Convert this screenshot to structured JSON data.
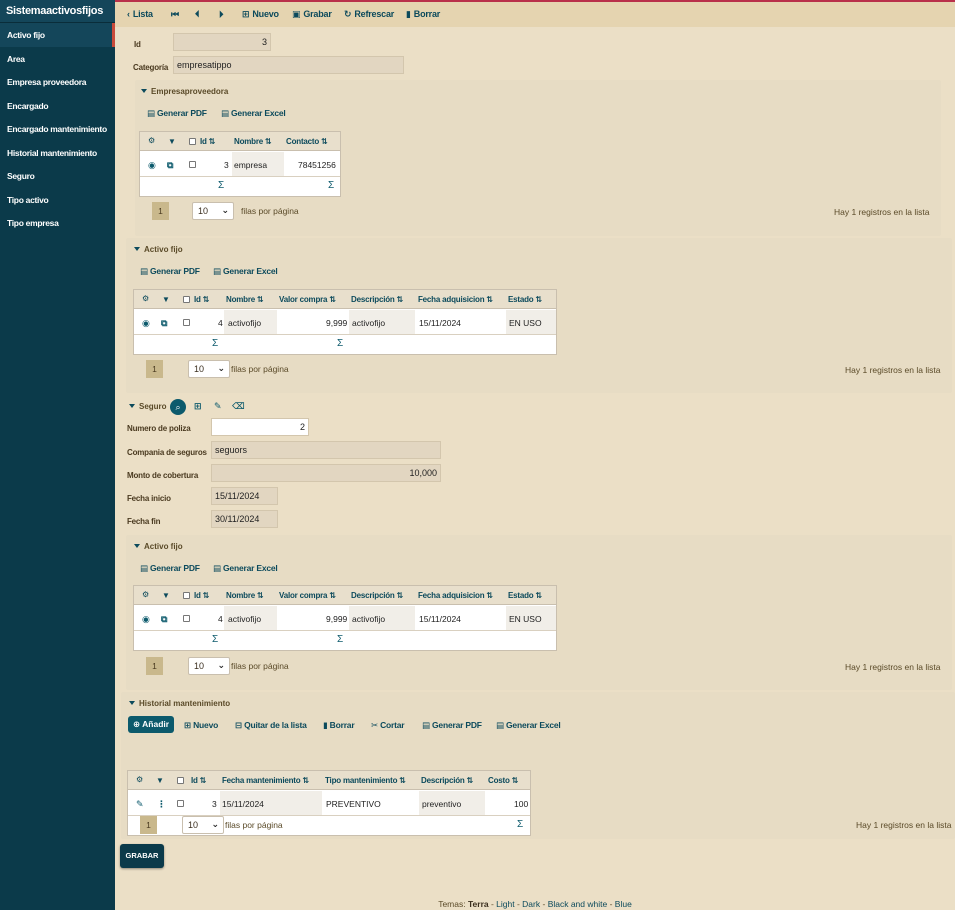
{
  "app": {
    "title": "Sistemaactivosfijos"
  },
  "sidebar": {
    "items": [
      {
        "label": "Activo fijo"
      },
      {
        "label": "Area"
      },
      {
        "label": "Empresa proveedora"
      },
      {
        "label": "Encargado"
      },
      {
        "label": "Encargado mantenimiento"
      },
      {
        "label": "Historial mantenimiento"
      },
      {
        "label": "Seguro"
      },
      {
        "label": "Tipo activo"
      },
      {
        "label": "Tipo empresa"
      }
    ]
  },
  "toolbar": {
    "lista": "Lista",
    "nuevo": "Nuevo",
    "grabar": "Grabar",
    "refrescar": "Refrescar",
    "borrar": "Borrar"
  },
  "form": {
    "id_label": "Id",
    "id_value": "3",
    "categoria_label": "Categoría",
    "categoria_value": "empresatippo"
  },
  "pdf_label": "Generar PDF",
  "excel_label": "Generar Excel",
  "per_page_label": "filas por página",
  "count_text": "Hay 1 registros en la lista",
  "page_number": "1",
  "page_size": "10",
  "sigma": "Σ",
  "empresa": {
    "title": "Empresaproveedora",
    "headers": {
      "id": "Id",
      "nombre": "Nombre",
      "contacto": "Contacto"
    },
    "row": {
      "id": "3",
      "nombre": "empresa",
      "contacto": "78451256"
    }
  },
  "activo1": {
    "title": "Activo fijo",
    "headers": {
      "id": "Id",
      "nombre": "Nombre",
      "valor": "Valor compra",
      "descripcion": "Descripción",
      "fecha": "Fecha adquisicion",
      "estado": "Estado"
    },
    "row": {
      "id": "4",
      "nombre": "activofijo",
      "valor": "9,999",
      "descripcion": "activofijo",
      "fecha": "15/11/2024",
      "estado": "EN USO"
    }
  },
  "seguro": {
    "title": "Seguro",
    "poliza_label": "Numero de poliza",
    "poliza_value": "2",
    "compania_label": "Compania de seguros",
    "compania_value": "seguors",
    "monto_label": "Monto de cobertura",
    "monto_value": "10,000",
    "inicio_label": "Fecha inicio",
    "inicio_value": "15/11/2024",
    "fin_label": "Fecha fin",
    "fin_value": "30/11/2024"
  },
  "activo2": {
    "title": "Activo fijo",
    "headers": {
      "id": "Id",
      "nombre": "Nombre",
      "valor": "Valor compra",
      "descripcion": "Descripción",
      "fecha": "Fecha adquisicion",
      "estado": "Estado"
    },
    "row": {
      "id": "4",
      "nombre": "activofijo",
      "valor": "9,999",
      "descripcion": "activofijo",
      "fecha": "15/11/2024",
      "estado": "EN USO"
    }
  },
  "historial": {
    "title": "Historial mantenimiento",
    "anadir": "Añadir",
    "nuevo": "Nuevo",
    "quitar": "Quitar de la lista",
    "borrar": "Borrar",
    "cortar": "Cortar",
    "headers": {
      "id": "Id",
      "fecha": "Fecha mantenimiento",
      "tipo": "Tipo mantenimiento",
      "descripcion": "Descripción",
      "costo": "Costo"
    },
    "row": {
      "id": "3",
      "fecha": "15/11/2024",
      "tipo": "PREVENTIVO",
      "descripcion": "preventivo",
      "costo": "100"
    }
  },
  "grabar_button": "GRABAR",
  "footer": {
    "prefix": "Temas:",
    "terra": "Terra",
    "light": "Light",
    "dark": "Dark",
    "bw": "Black and white",
    "blue": "Blue",
    "sep": " - "
  }
}
